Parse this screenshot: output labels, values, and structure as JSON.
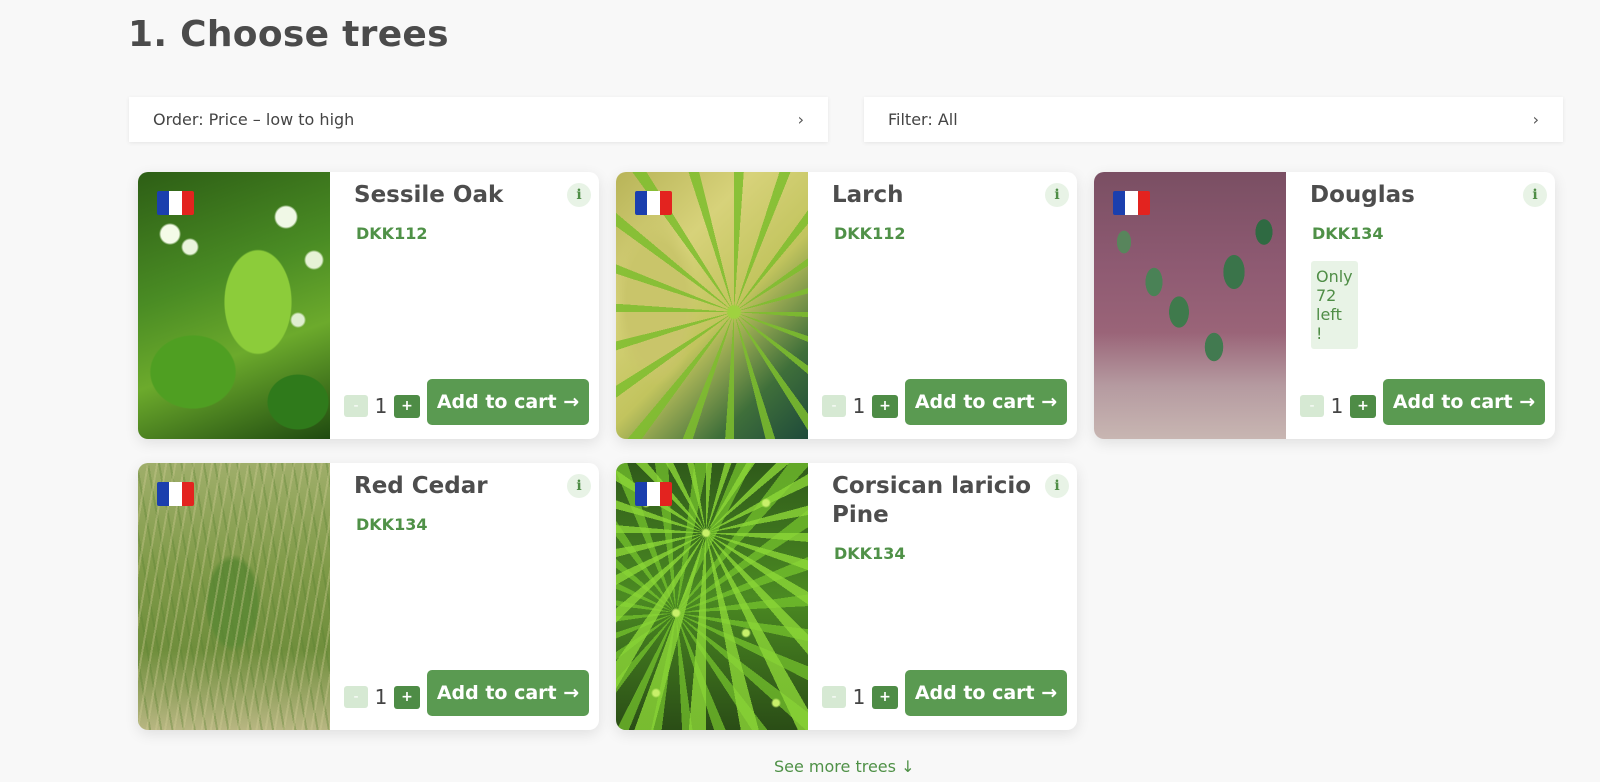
{
  "page": {
    "title": "1. Choose trees"
  },
  "controls": {
    "order_label": "Order: Price – low to high",
    "filter_label": "Filter: All",
    "chevron": "›"
  },
  "product_actions": {
    "minus": "-",
    "plus": "+",
    "add_to_cart": "Add to cart →",
    "info": "i"
  },
  "products": [
    {
      "name": "Sessile Oak",
      "code": "DKK112",
      "quantity": "1",
      "origin_flag": "france-flag",
      "stock_note": ""
    },
    {
      "name": "Larch",
      "code": "DKK112",
      "quantity": "1",
      "origin_flag": "france-flag",
      "stock_note": ""
    },
    {
      "name": "Douglas",
      "code": "DKK134",
      "quantity": "1",
      "origin_flag": "france-flag",
      "stock_note": "Only 72 left !"
    },
    {
      "name": "Red Cedar",
      "code": "DKK134",
      "quantity": "1",
      "origin_flag": "france-flag",
      "stock_note": ""
    },
    {
      "name": "Corsican laricio Pine",
      "code": "DKK134",
      "quantity": "1",
      "origin_flag": "france-flag",
      "stock_note": ""
    }
  ],
  "footer": {
    "see_more": "See more trees ↓"
  },
  "colors": {
    "accent_green": "#5a9a51",
    "code_green": "#4f9147",
    "badge_bg": "#e8f3e6",
    "page_bg": "#f8f8f8"
  }
}
